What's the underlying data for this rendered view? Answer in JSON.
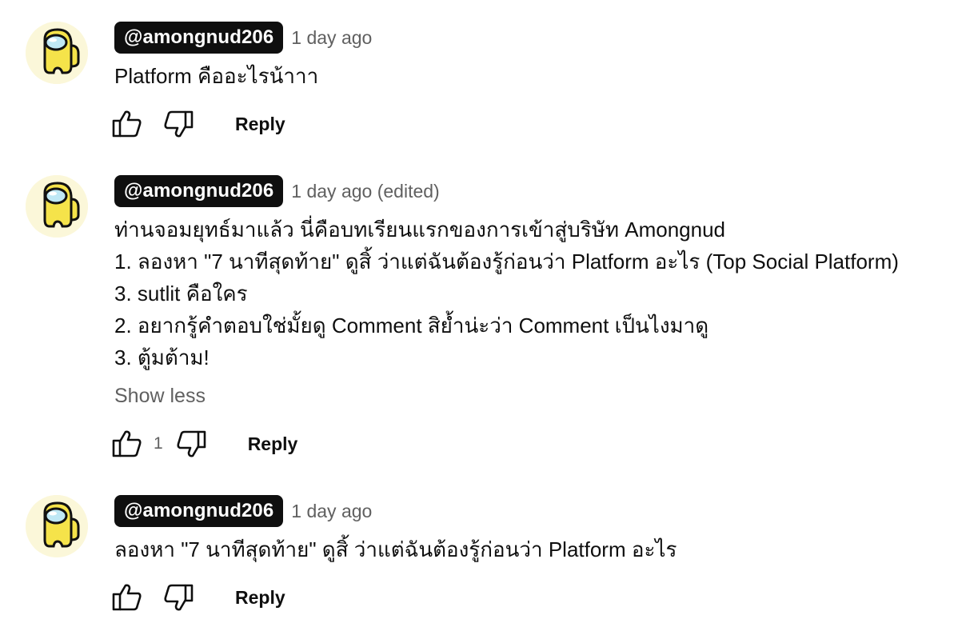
{
  "comments": [
    {
      "author": "@amongnud206",
      "time": "1 day ago",
      "lines": [
        "Platform คืออะไรน้าาา"
      ],
      "like_count": "",
      "reply_label": "Reply"
    },
    {
      "author": "@amongnud206",
      "time": "1 day ago (edited)",
      "lines": [
        "ท่านจอมยุทธ์มาแล้ว นี่คือบทเรียนแรกของการเข้าสู่บริษัท Amongnud",
        "1. ลองหา \"7 นาทีสุดท้าย\" ดูสิ้ ว่าแต่ฉันต้องรู้ก่อนว่า Platform อะไร (Top Social Platform)",
        "3. sutlit คือใคร",
        "2. อยากรู้คำตอบใช่มั้ยดู Comment สิย้ำน่ะว่า Comment เป็นไงมาดู",
        "3. ตู้มต้าม!"
      ],
      "show_less_label": "Show less",
      "like_count": "1",
      "reply_label": "Reply"
    },
    {
      "author": "@amongnud206",
      "time": "1 day ago",
      "lines": [
        "ลองหา \"7 นาทีสุดท้าย\" ดูสิ้ ว่าแต่ฉันต้องรู้ก่อนว่า Platform อะไร"
      ],
      "like_count": "",
      "reply_label": "Reply"
    }
  ],
  "icons": {
    "avatar": "among-us-crewmate-icon",
    "like": "thumbs-up-icon",
    "dislike": "thumbs-down-icon"
  },
  "colors": {
    "author_bg": "#0f0f0f",
    "secondary_text": "#606060",
    "crewmate_yellow": "#f5e34a",
    "visor": "#bfe8f5"
  }
}
